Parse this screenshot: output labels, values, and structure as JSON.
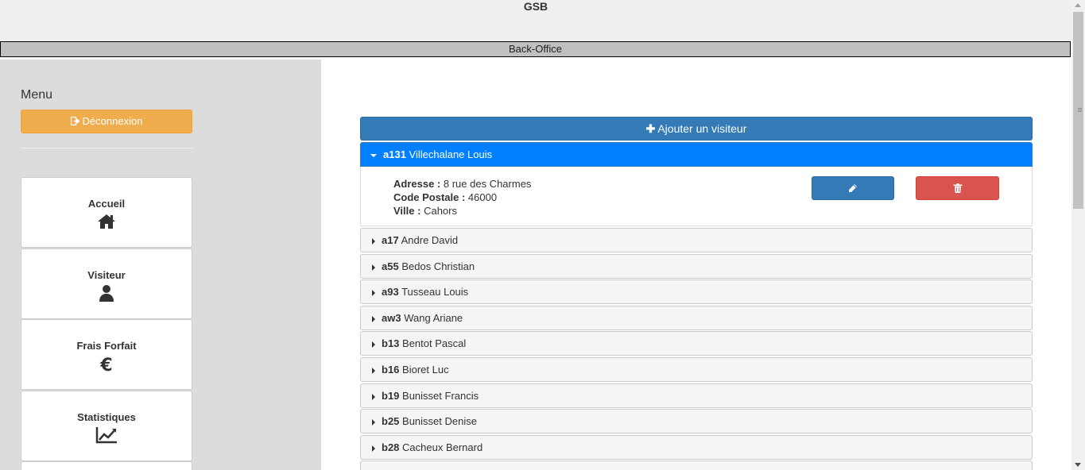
{
  "header": {
    "title": "GSB",
    "subtitle": "Back-Office"
  },
  "sidebar": {
    "menu_title": "Menu",
    "logout_label": "Déconnexion",
    "items": [
      {
        "label": "Accueil",
        "icon": "home-icon"
      },
      {
        "label": "Visiteur",
        "icon": "user-icon"
      },
      {
        "label": "Frais Forfait",
        "icon": "euro-icon"
      },
      {
        "label": "Statistiques",
        "icon": "chart-line-icon"
      }
    ]
  },
  "main": {
    "add_button_label": "Ajouter un visiteur",
    "expanded_visitor": {
      "id": "a131",
      "name": "Villechalane Louis",
      "address_label": "Adresse :",
      "address": "8 rue des Charmes",
      "postal_label": "Code Postale :",
      "postal": "46000",
      "city_label": "Ville :",
      "city": "Cahors"
    },
    "visitors": [
      {
        "id": "a17",
        "name": "Andre David"
      },
      {
        "id": "a55",
        "name": "Bedos Christian"
      },
      {
        "id": "a93",
        "name": "Tusseau Louis"
      },
      {
        "id": "aw3",
        "name": "Wang Ariane"
      },
      {
        "id": "b13",
        "name": "Bentot Pascal"
      },
      {
        "id": "b16",
        "name": "Bioret Luc"
      },
      {
        "id": "b19",
        "name": "Bunisset Francis"
      },
      {
        "id": "b25",
        "name": "Bunisset Denise"
      },
      {
        "id": "b28",
        "name": "Cacheux Bernard"
      }
    ]
  },
  "colors": {
    "primary": "#337ab7",
    "active": "#0080ff",
    "warning": "#f0ad4e",
    "danger": "#d9534f"
  }
}
